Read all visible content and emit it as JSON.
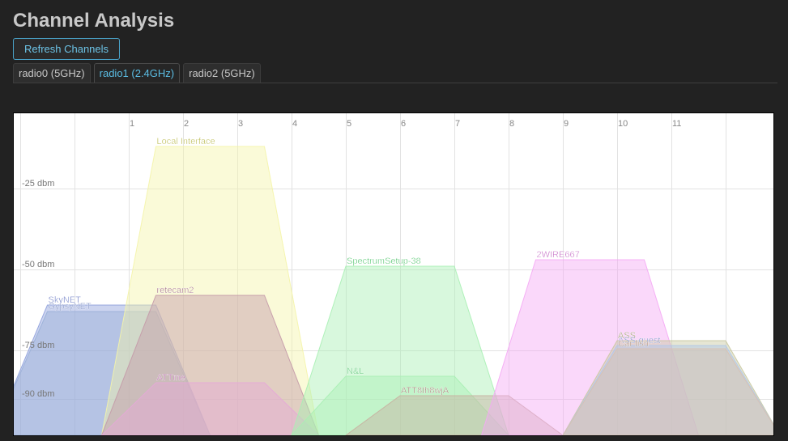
{
  "page": {
    "title": "Channel Analysis"
  },
  "toolbar": {
    "refresh_label": "Refresh Channels"
  },
  "tabs": [
    {
      "label": "radio0 (5GHz)",
      "active": false
    },
    {
      "label": "radio1 (2.4GHz)",
      "active": true
    },
    {
      "label": "radio2 (5GHz)",
      "active": false
    }
  ],
  "chart_data": {
    "type": "area",
    "title": "",
    "xlabel": "",
    "ylabel": "",
    "x_ticks": [
      "1",
      "2",
      "3",
      "4",
      "5",
      "6",
      "7",
      "8",
      "9",
      "10",
      "11"
    ],
    "y_ticks": [
      {
        "value": -25,
        "label": "-25 dbm"
      },
      {
        "value": -50,
        "label": "-50 dbm"
      },
      {
        "value": -75,
        "label": "-75 dbm"
      },
      {
        "value": -90,
        "label": "-90 dbm"
      }
    ],
    "xlim": [
      -1,
      13
    ],
    "ylim": [
      -102,
      -2
    ],
    "grid": true,
    "series": [
      {
        "name": "SkyNET",
        "channel": 0.5,
        "signal": -61,
        "color": "#8ea0dc",
        "label_color": "#6c7cc4"
      },
      {
        "name": "GypsyNET",
        "channel": 0.5,
        "signal": -63,
        "color": "#9ab0d8",
        "label_color": "#7d8fc4"
      },
      {
        "name": "Local Interface",
        "channel": 2.5,
        "signal": -12,
        "color": "#f4f4a8",
        "label_color": "#b8b84a"
      },
      {
        "name": "retecam2",
        "channel": 2.5,
        "signal": -58,
        "color": "#c49aa8",
        "label_color": "#a06a7e"
      },
      {
        "name": "ATTme",
        "channel": 2.5,
        "signal": -85,
        "color": "#e6a8d8",
        "label_color": "#b86aa8"
      },
      {
        "name": "SpectrumSetup-38",
        "channel": 6.0,
        "signal": -49,
        "color": "#a8f0b4",
        "label_color": "#4ec46a"
      },
      {
        "name": "N&L",
        "channel": 6.0,
        "signal": -83,
        "color": "#a8f0b4",
        "label_color": "#4ec46a"
      },
      {
        "name": "ATT8Ih8wjA",
        "channel": 7.0,
        "signal": -89,
        "color": "#c8b0a0",
        "label_color": "#9a7a6a"
      },
      {
        "name": "2WIRE667",
        "channel": 9.5,
        "signal": -47,
        "color": "#f4a8f4",
        "label_color": "#c46ac4"
      },
      {
        "name": "ASS",
        "channel": 11.0,
        "signal": -72,
        "color": "#c8c8a0",
        "label_color": "#9a9a6a"
      },
      {
        "name": "ASS-guest",
        "channel": 11.0,
        "signal": -73.5,
        "color": "#b0c8e8",
        "label_color": "#7a8ac4"
      },
      {
        "name": "Car fish",
        "channel": 11.0,
        "signal": -74.5,
        "color": "#d8c0b0",
        "label_color": "#a88a7a"
      }
    ]
  }
}
